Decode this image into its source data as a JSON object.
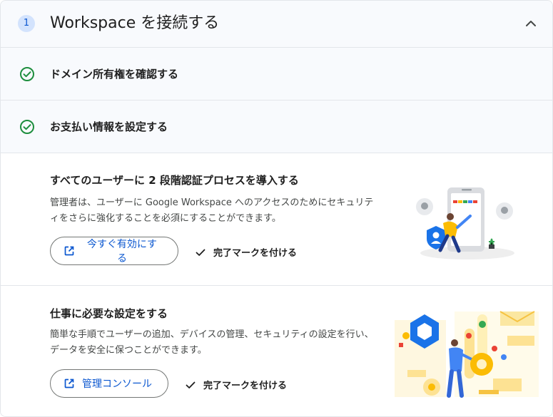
{
  "header": {
    "step_number": "1",
    "title": "Workspace を接続する",
    "collapse_icon": "chevron-up-icon"
  },
  "completed_steps": [
    {
      "label": "ドメイン所有権を確認する",
      "icon": "check-circle-icon",
      "color": "#1e8e3e"
    },
    {
      "label": "お支払い情報を設定する",
      "icon": "check-circle-icon",
      "color": "#1e8e3e"
    }
  ],
  "tasks": [
    {
      "title": "すべてのユーザーに 2 段階認証プロセスを導入する",
      "description": "管理者は、ユーザーに Google Workspace へのアクセスのためにセキュリティをさらに強化することを必須にすることができます。",
      "action_label": "今すぐ有効にする",
      "action_icon": "open-in-new-icon",
      "mark_done_label": "完了マークを付ける",
      "mark_done_icon": "check-icon"
    },
    {
      "title": "仕事に必要な設定をする",
      "description": "簡単な手順でユーザーの追加、デバイスの管理、セキュリティの設定を行い、データを安全に保つことができます。",
      "action_label": "管理コンソール",
      "action_icon": "open-in-new-icon",
      "mark_done_label": "完了マークを付ける",
      "mark_done_icon": "check-icon"
    }
  ],
  "colors": {
    "accent": "#0b57d0",
    "success": "#1e8e3e",
    "header_bg": "#f8fafd",
    "step_badge_bg": "#d3e3fd"
  }
}
